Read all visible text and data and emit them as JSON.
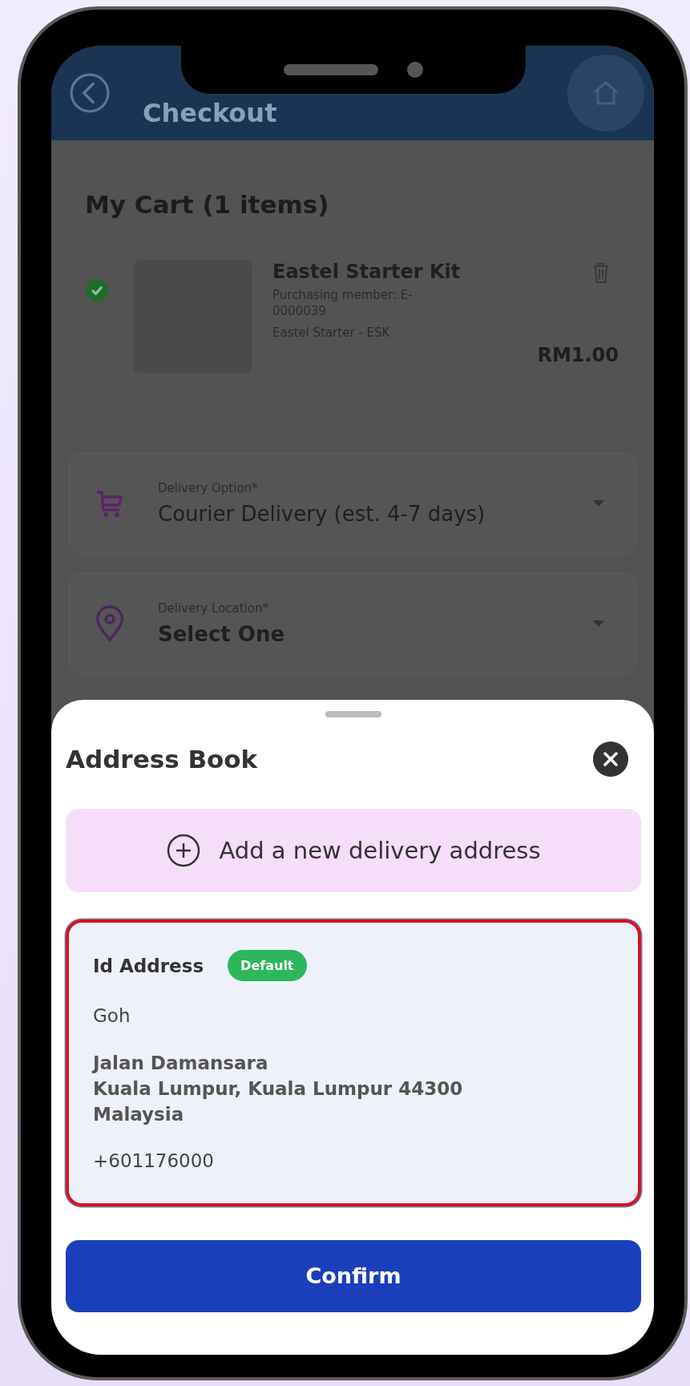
{
  "header": {
    "title": "Checkout"
  },
  "cart": {
    "title": "My Cart (1 items)",
    "items": [
      {
        "name": "Eastel Starter Kit",
        "member": "Purchasing member: E-0000039",
        "variant": "Eastel Starter - ESK",
        "price": "RM1.00",
        "checked": true
      }
    ]
  },
  "delivery_fields": [
    {
      "kind": "option",
      "label": "Delivery Option*",
      "value": "Courier Delivery (est. 4-7 days)"
    },
    {
      "kind": "location",
      "label": "Delivery Location*",
      "value": "Select One"
    }
  ],
  "address_sheet": {
    "title": "Address Book",
    "add_button": "Add a new delivery address",
    "addresses": [
      {
        "label": "Id Address",
        "is_default": true,
        "default_badge": "Default",
        "name": "Goh",
        "lines": [
          "Jalan Damansara",
          "Kuala Lumpur, Kuala Lumpur 44300",
          "Malaysia"
        ],
        "phone": "+601176000",
        "selected": true
      }
    ],
    "confirm_button": "Confirm"
  }
}
